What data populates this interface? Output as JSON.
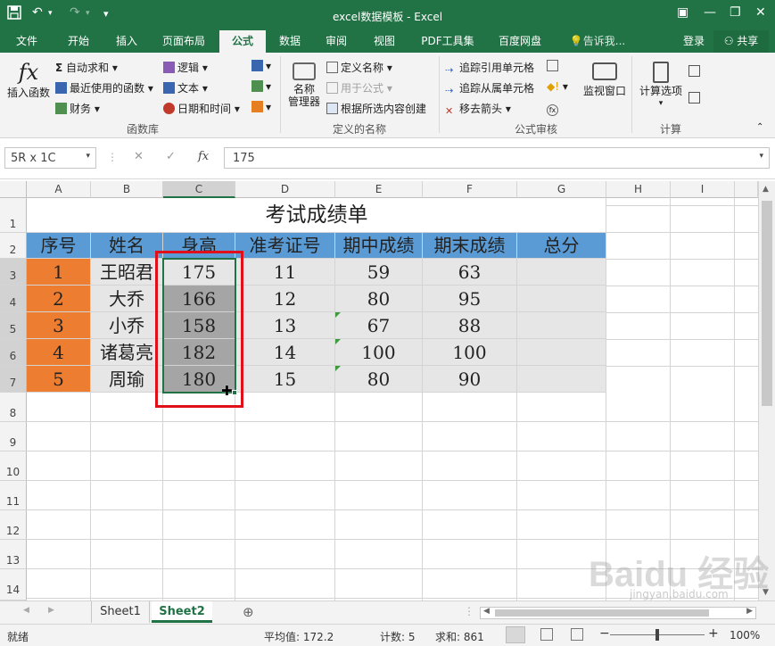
{
  "window": {
    "title": "excel数据模板 - Excel",
    "qat": {
      "save_icon": "save-icon",
      "undo": "↶",
      "redo": "↷",
      "customize": "▾"
    },
    "controls": {
      "ribbon_display": "▣",
      "minimize": "—",
      "restore": "❐",
      "close": "✕"
    }
  },
  "tabs": [
    {
      "label": "文件"
    },
    {
      "label": "开始"
    },
    {
      "label": "插入"
    },
    {
      "label": "页面布局"
    },
    {
      "label": "公式"
    },
    {
      "label": "数据"
    },
    {
      "label": "审阅"
    },
    {
      "label": "视图"
    },
    {
      "label": "PDF工具集"
    },
    {
      "label": "百度网盘"
    },
    {
      "label": "告诉我..."
    }
  ],
  "account": {
    "login": "登录",
    "share": "共享"
  },
  "ribbon": {
    "insert_function": "插入函数",
    "autosum": "自动求和",
    "recent": "最近使用的函数",
    "finance": "财务",
    "logic": "逻辑",
    "text": "文本",
    "datetime": "日期和时间",
    "group_lib": "函数库",
    "name_manager_1": "名称",
    "name_manager_2": "管理器",
    "define_name": "定义名称",
    "use_in_formula": "用于公式",
    "create_from_sel": "根据所选内容创建",
    "group_names": "定义的名称",
    "trace_precedents": "追踪引用单元格",
    "trace_dependents": "追踪从属单元格",
    "remove_arrows": "移去箭头",
    "group_audit": "公式审核",
    "watch_window": "监视窗口",
    "calc_options": "计算选项",
    "group_calc": "计算"
  },
  "formula_bar": {
    "name_box": "5R x 1C",
    "cancel": "✕",
    "enter": "✓",
    "fx": "fx",
    "value": "175"
  },
  "columns": [
    "A",
    "B",
    "C",
    "D",
    "E",
    "F",
    "G",
    "H",
    "I"
  ],
  "rows": [
    "1",
    "2",
    "3",
    "4",
    "5",
    "6",
    "7",
    "8",
    "9",
    "10",
    "11",
    "12",
    "13",
    "14"
  ],
  "sheet": {
    "title": "考试成绩单",
    "headers": [
      "序号",
      "姓名",
      "身高",
      "准考证号",
      "期中成绩",
      "期末成绩",
      "总分"
    ],
    "data": [
      [
        "1",
        "王昭君",
        "175",
        "11",
        "59",
        "63",
        ""
      ],
      [
        "2",
        "大乔",
        "166",
        "12",
        "80",
        "95",
        ""
      ],
      [
        "3",
        "小乔",
        "158",
        "13",
        "67",
        "88",
        ""
      ],
      [
        "4",
        "诸葛亮",
        "182",
        "14",
        "100",
        "100",
        ""
      ],
      [
        "5",
        "周瑜",
        "180",
        "15",
        "80",
        "90",
        ""
      ]
    ]
  },
  "sheet_tabs": [
    {
      "label": "Sheet1"
    },
    {
      "label": "Sheet2"
    }
  ],
  "add_sheet": "⊕",
  "status": {
    "ready": "就绪",
    "average": "平均值: 172.2",
    "count": "计数: 5",
    "sum": "求和: 861",
    "zoom": "100%",
    "zoom_minus": "−",
    "zoom_plus": "+"
  },
  "colors": {
    "excel_green": "#217346",
    "header_blue": "#5b9bd5",
    "index_orange": "#ed7d31",
    "data_gray": "#e7e6e6",
    "selection_gray": "#a5a5a5",
    "highlight_red": "#e0101a"
  }
}
